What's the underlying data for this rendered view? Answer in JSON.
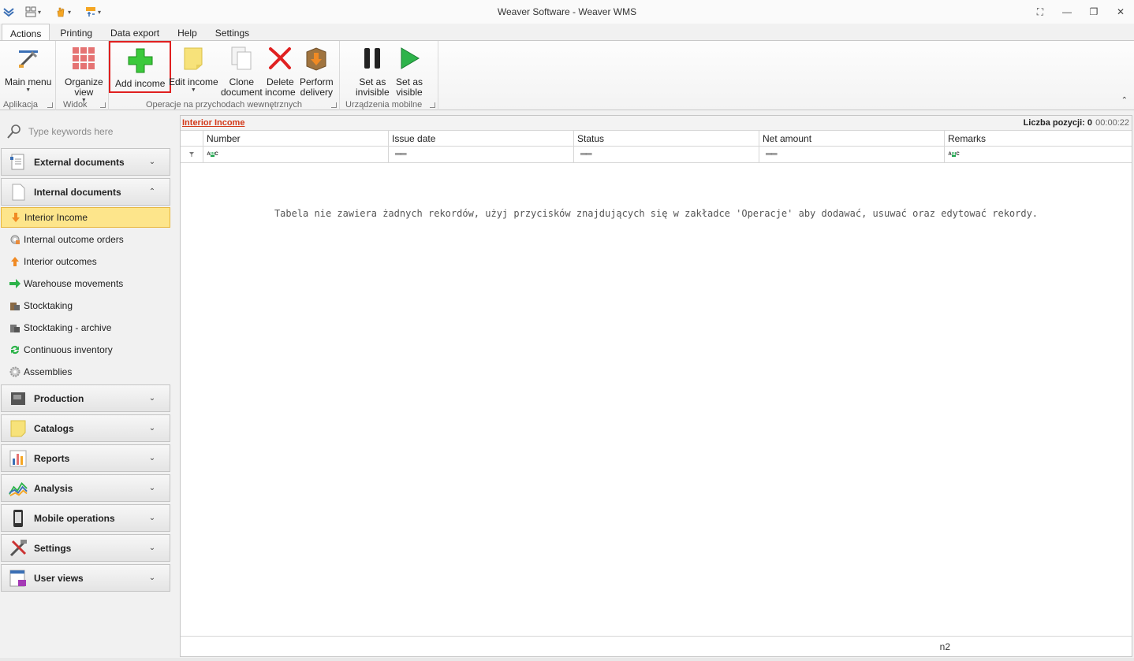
{
  "window": {
    "title": "Weaver Software - Weaver WMS"
  },
  "tabs": [
    "Actions",
    "Printing",
    "Data export",
    "Help",
    "Settings"
  ],
  "ribbon": {
    "groups": {
      "aplikacja": "Aplikacja",
      "widok": "Widok",
      "operacje": "Operacje na przychodach wewnętrznych",
      "urzadzenia": "Urządzenia mobilne"
    },
    "buttons": {
      "main_menu": "Main menu",
      "organize_view_1": "Organize",
      "organize_view_2": "view",
      "add_income": "Add income",
      "edit_income": "Edit income",
      "clone_1": "Clone",
      "clone_2": "document",
      "delete_1": "Delete",
      "delete_2": "income",
      "perform_1": "Perform",
      "perform_2": "delivery",
      "invisible_1": "Set as",
      "invisible_2": "invisible",
      "visible_1": "Set as",
      "visible_2": "visible"
    }
  },
  "sidebar": {
    "search_placeholder": "Type keywords here",
    "groups": {
      "external": "External documents",
      "internal": "Internal documents",
      "production": "Production",
      "catalogs": "Catalogs",
      "reports": "Reports",
      "analysis": "Analysis",
      "mobile": "Mobile operations",
      "settings": "Settings",
      "user_views": "User views"
    },
    "items": [
      "Interior Income",
      "Internal outcome orders",
      "Interior outcomes",
      "Warehouse movements",
      "Stocktaking",
      "Stocktaking - archive",
      "Continuous inventory",
      "Assemblies"
    ]
  },
  "main": {
    "title": "Interior Income",
    "count_label": "Liczba pozycji: 0",
    "time": "00:00:22",
    "columns": [
      "Number",
      "Issue date",
      "Status",
      "Net amount",
      "Remarks"
    ],
    "empty_message": "Tabela nie zawiera żadnych rekordów, użyj przycisków znajdujących się w zakładce 'Operacje' aby dodawać, usuwać oraz edytować rekordy.",
    "footer": "n2"
  }
}
